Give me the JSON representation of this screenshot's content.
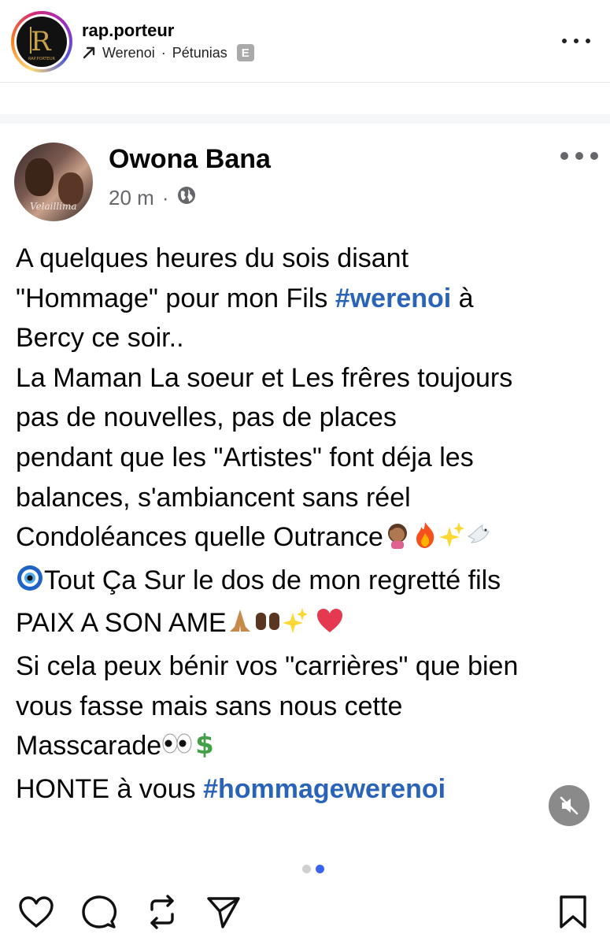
{
  "instagram": {
    "username": "rap.porteur",
    "audio_artist": "Werenoi",
    "audio_separator": "·",
    "audio_title": "Pétunias",
    "explicit_badge": "E",
    "avatar_logo_letter": "R",
    "avatar_logo_caption": "RAP.PORTEUR"
  },
  "post": {
    "author_name": "Owona Bana",
    "timestamp": "20 m",
    "meta_separator": "·",
    "privacy_icon": "globe-icon",
    "avatar_signature": "Velaillima",
    "lines": [
      [
        "A quelques heures du sois disant"
      ],
      [
        "\"Hommage\" pour mon Fils ",
        "#werenoi",
        " à"
      ],
      [
        "Bercy ce soir.."
      ],
      [
        "La Maman La soeur et Les frêres toujours"
      ],
      [
        "pas de nouvelles, pas de places"
      ],
      [
        "pendant que les \"Artistes\" font déja les"
      ],
      [
        "balances, s'ambiancent sans réel"
      ],
      [
        "Condoléances quelle Outrance"
      ],
      [
        "Tout Ça Sur le dos de mon regretté fils"
      ],
      [
        "PAIX A SON AME"
      ],
      [
        "Si cela peux bénir vos \"carrières\" que bien"
      ],
      [
        "vous fasse mais sans nous cette"
      ],
      [
        "Masscarade"
      ],
      [
        " HONTE à vous ",
        "#hommagewerenoi"
      ]
    ],
    "emoji_line8": [
      "facepalm-woman-emoji",
      "fire-emoji",
      "sparkles-emoji",
      "dove-emoji"
    ],
    "emoji_line9_prefix": "nazar-eye-emoji",
    "emoji_line10": [
      "praying-hands-emoji",
      "raised-hands-emoji",
      "sparkles-emoji",
      "red-heart-emoji"
    ],
    "emoji_line13": [
      "eyes-emoji",
      "dollar-sign-emoji"
    ]
  },
  "carousel": {
    "total": 2,
    "active_index": 2
  },
  "colors": {
    "hashtag": "#2a64b8",
    "meta_gray": "#65676b",
    "dot_active": "#3a64f0",
    "dot_inactive": "#d0d0d0"
  },
  "actions": [
    "like-icon",
    "comment-icon",
    "repost-icon",
    "share-icon",
    "save-icon"
  ]
}
